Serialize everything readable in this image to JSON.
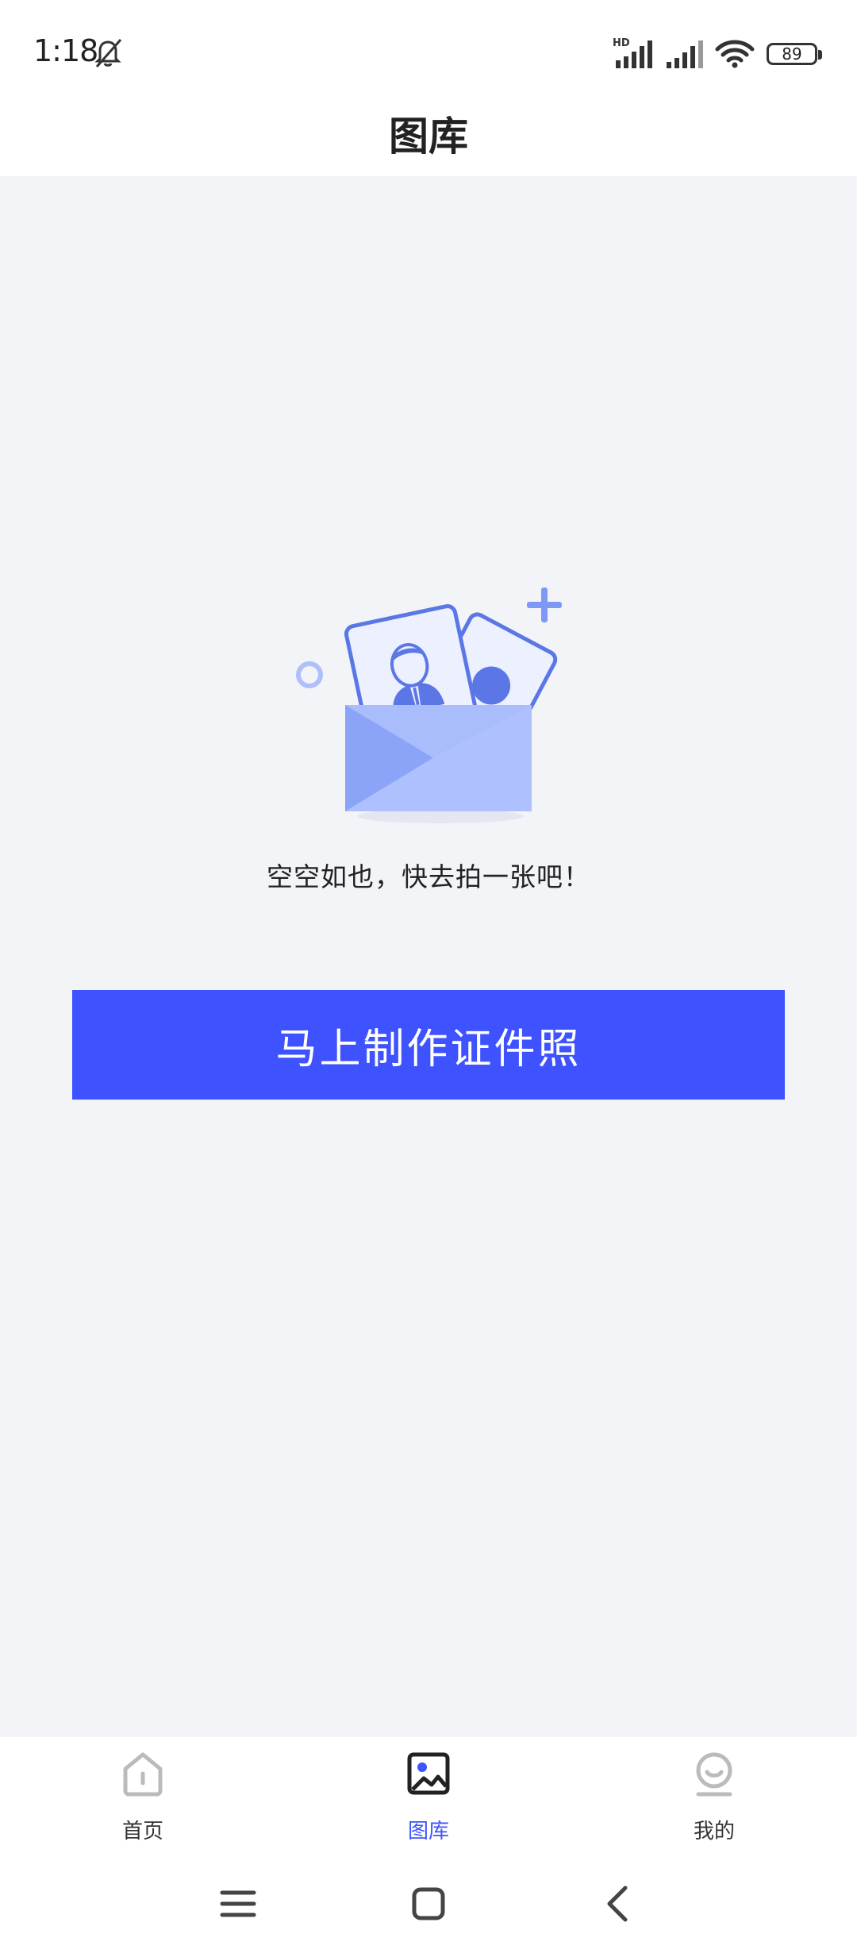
{
  "status": {
    "time": "1:18",
    "signal_label": "HD",
    "battery": "89"
  },
  "header": {
    "title": "图库"
  },
  "empty_state": {
    "message": "空空如也，快去拍一张吧！",
    "cta_label": "马上制作证件照"
  },
  "tabs": [
    {
      "label": "首页",
      "icon": "home-icon"
    },
    {
      "label": "图库",
      "icon": "gallery-icon",
      "active": true
    },
    {
      "label": "我的",
      "icon": "profile-icon"
    }
  ],
  "colors": {
    "accent": "#3e52ff",
    "background": "#f3f4f8",
    "illustration_blue": "#5b77e6"
  }
}
